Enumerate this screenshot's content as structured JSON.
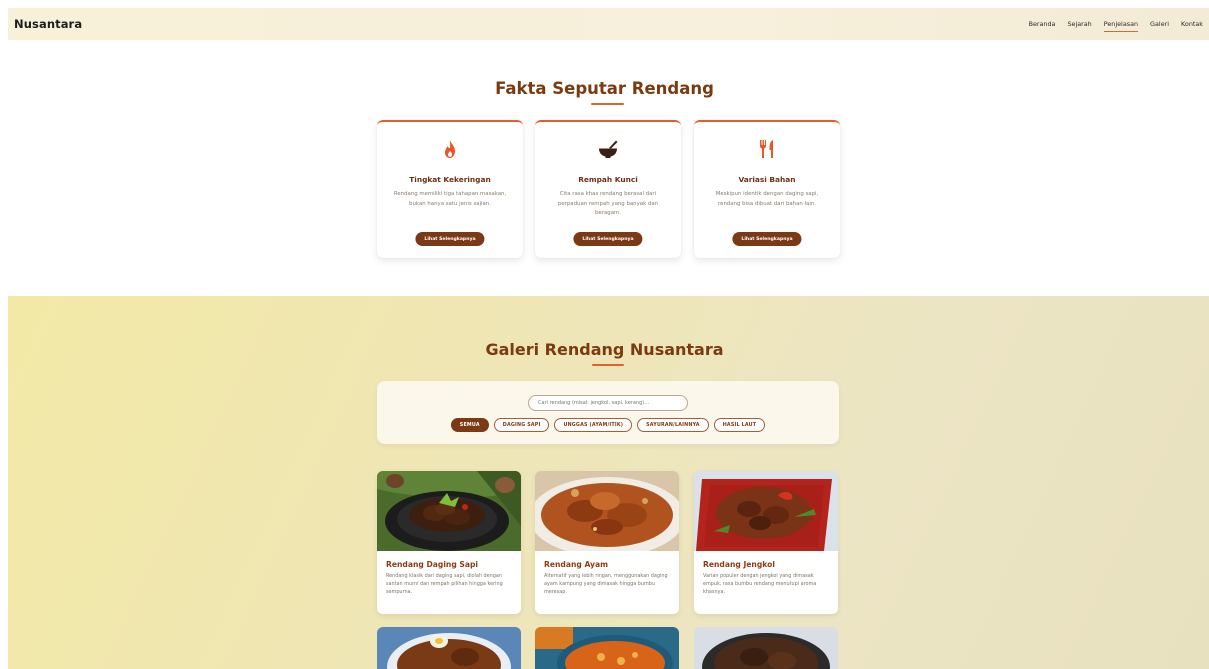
{
  "navbar": {
    "brand": "Nusantara",
    "links": [
      "Beranda",
      "Sejarah",
      "Penjelasan",
      "Galeri",
      "Kontak"
    ],
    "active": "Penjelasan"
  },
  "fakta": {
    "title": "Fakta Seputar Rendang",
    "cards": [
      {
        "icon": "fire-icon",
        "title": "Tingkat Kekeringan",
        "desc": "Rendang memiliki tiga tahapan masakan, bukan hanya satu jenis sajian.",
        "button": "Lihat Selengkapnya"
      },
      {
        "icon": "mortar-pestle-icon",
        "title": "Rempah Kunci",
        "desc": "Cita rasa khas rendang berasal dari perpaduan rempah yang banyak dan beragam.",
        "button": "Lihat Selengkapnya"
      },
      {
        "icon": "utensils-icon",
        "title": "Variasi Bahan",
        "desc": "Meskipun identik dengan daging sapi, rendang bisa dibuat dari bahan lain.",
        "button": "Lihat Selengkapnya"
      }
    ]
  },
  "galeri": {
    "title": "Galeri Rendang Nusantara",
    "search_placeholder": "Cari rendang (misal: jengkol, sapi, kerang)...",
    "filters": [
      "SEMUA",
      "DAGING SAPI",
      "UNGGAS (AYAM/ITIK)",
      "SAYURAN/LAINNYA",
      "HASIL LAUT"
    ],
    "active_filter": "SEMUA",
    "items": [
      {
        "title": "Rendang Daging Sapi",
        "desc": "Rendang klasik dari daging sapi, diolah dengan santan murni dan rempah pilihan hingga kering sempurna."
      },
      {
        "title": "Rendang Ayam",
        "desc": "Alternatif yang lebih ringan, menggunakan daging ayam kampung yang dimasak hingga bumbu meresap."
      },
      {
        "title": "Rendang Jengkol",
        "desc": "Varian populer dengan jengkol yang dimasak empuk, rasa bumbu rendang menutupi aroma khasnya."
      }
    ]
  },
  "colors": {
    "accent": "#e0612f",
    "brown": "#7b3a15",
    "title_brown": "#7a3b10"
  }
}
